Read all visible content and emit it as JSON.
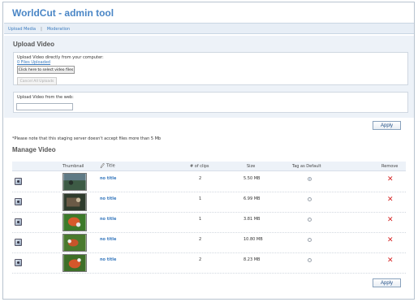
{
  "app": {
    "title": "WorldCut - admin tool"
  },
  "nav": {
    "upload_media": "Upload Media",
    "separator": "|",
    "moderation": "Moderation"
  },
  "upload": {
    "section_title": "Upload Video",
    "computer_label": "Upload Video directly from your computer:",
    "files_uploaded": "0 Files Uploaded",
    "select_button": "Click here to select video files",
    "cancel_button": "Cancel All Uploads",
    "web_label": "Upload Video from the web:",
    "web_input_value": "",
    "apply_label": "Apply",
    "note": "*Please note that this staging server doesn't accept files more than 5 Mb"
  },
  "manage": {
    "section_title": "Manage Video",
    "columns": {
      "thumbnail": "Thumbnail",
      "title": "Title",
      "clips": "# of clips",
      "size": "Size",
      "tag_default": "Tag as Default",
      "remove": "Remove"
    },
    "rows": [
      {
        "title": "no title",
        "clips": "2",
        "size": "5.50 MB",
        "is_default": true
      },
      {
        "title": "no title",
        "clips": "1",
        "size": "6.99 MB",
        "is_default": false
      },
      {
        "title": "no title",
        "clips": "1",
        "size": "3.81 MB",
        "is_default": false
      },
      {
        "title": "no title",
        "clips": "2",
        "size": "10.80 MB",
        "is_default": false
      },
      {
        "title": "no title",
        "clips": "2",
        "size": "8.23 MB",
        "is_default": false
      }
    ],
    "remove_icon": "red-x-icon",
    "apply_label": "Apply"
  },
  "colors": {
    "brand": "#4a86c6",
    "link": "#3b7bbf",
    "panel": "#edf2f8",
    "remove": "#d42020"
  }
}
